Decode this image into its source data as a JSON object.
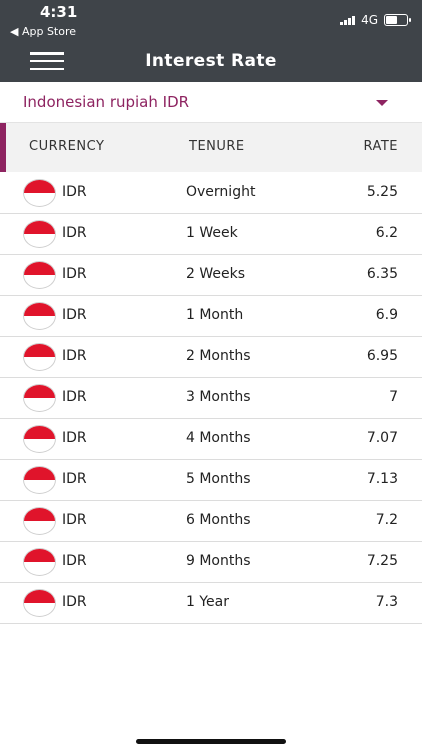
{
  "status_bar": {
    "time": "4:31",
    "back_label": "◀ App Store",
    "network": "4G"
  },
  "header": {
    "title": "Interest Rate"
  },
  "selector": {
    "label": "Indonesian rupiah IDR"
  },
  "table": {
    "columns": [
      "CURRENCY",
      "TENURE",
      "RATE"
    ],
    "rows": [
      {
        "currency": "IDR",
        "tenure": "Overnight",
        "rate": "5.25"
      },
      {
        "currency": "IDR",
        "tenure": "1 Week",
        "rate": "6.2"
      },
      {
        "currency": "IDR",
        "tenure": "2 Weeks",
        "rate": "6.35"
      },
      {
        "currency": "IDR",
        "tenure": "1 Month",
        "rate": "6.9"
      },
      {
        "currency": "IDR",
        "tenure": "2 Months",
        "rate": "6.95"
      },
      {
        "currency": "IDR",
        "tenure": "3 Months",
        "rate": "7"
      },
      {
        "currency": "IDR",
        "tenure": "4 Months",
        "rate": "7.07"
      },
      {
        "currency": "IDR",
        "tenure": "5 Months",
        "rate": "7.13"
      },
      {
        "currency": "IDR",
        "tenure": "6 Months",
        "rate": "7.2"
      },
      {
        "currency": "IDR",
        "tenure": "9 Months",
        "rate": "7.25"
      },
      {
        "currency": "IDR",
        "tenure": "1 Year",
        "rate": "7.3"
      }
    ]
  },
  "colors": {
    "topbar": "#3f4449",
    "accent": "#8e2461",
    "flag_red": "#e0142b"
  },
  "icons": {
    "menu": "hamburger-icon",
    "dropdown": "caret-down-icon",
    "flag": "indonesia-flag-icon"
  }
}
